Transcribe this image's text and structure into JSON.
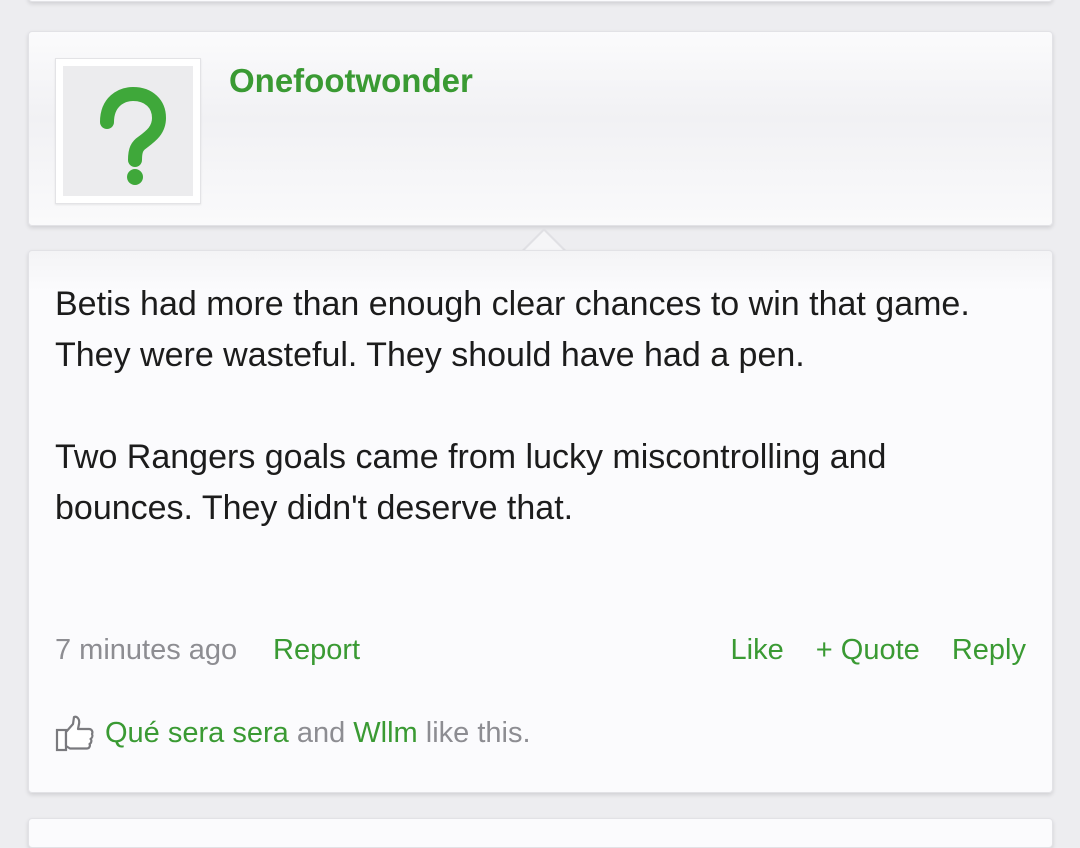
{
  "post": {
    "username": "Onefootwonder",
    "avatar_icon": "question-mark-icon",
    "body": [
      "Betis had more than enough clear chances to win that game. They were wasteful. They should have had a pen.",
      "Two Rangers goals came from lucky miscontrolling and bounces. They didn't deserve that."
    ],
    "timestamp": "7 minutes ago",
    "report_label": "Report",
    "like_label": "Like",
    "quote_label": "+ Quote",
    "reply_label": "Reply",
    "likes": {
      "icon": "thumbs-up-icon",
      "user1": "Qué sera sera",
      "connector": "and",
      "user2": "Wllm",
      "suffix": "like this."
    }
  },
  "colors": {
    "accent": "#3a9a33",
    "muted": "#8d8d92",
    "text": "#1c1c1c",
    "background": "#ededf0",
    "card": "#fbfbfd"
  }
}
